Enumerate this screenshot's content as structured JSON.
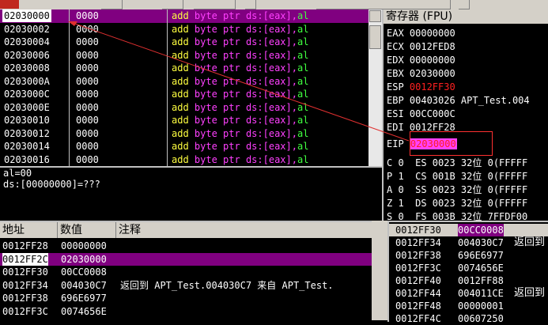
{
  "disasm": {
    "rows": [
      {
        "addr": "02030000",
        "hex": "0000",
        "op": "add",
        "rest": "byte ptr ds:[eax],",
        "reg": "al",
        "selected": true
      },
      {
        "addr": "02030002",
        "hex": "0000",
        "op": "add",
        "rest": "byte ptr ds:[eax],",
        "reg": "al"
      },
      {
        "addr": "02030004",
        "hex": "0000",
        "op": "add",
        "rest": "byte ptr ds:[eax],",
        "reg": "al"
      },
      {
        "addr": "02030006",
        "hex": "0000",
        "op": "add",
        "rest": "byte ptr ds:[eax],",
        "reg": "al"
      },
      {
        "addr": "02030008",
        "hex": "0000",
        "op": "add",
        "rest": "byte ptr ds:[eax],",
        "reg": "al"
      },
      {
        "addr": "0203000A",
        "hex": "0000",
        "op": "add",
        "rest": "byte ptr ds:[eax],",
        "reg": "al"
      },
      {
        "addr": "0203000C",
        "hex": "0000",
        "op": "add",
        "rest": "byte ptr ds:[eax],",
        "reg": "al"
      },
      {
        "addr": "0203000E",
        "hex": "0000",
        "op": "add",
        "rest": "byte ptr ds:[eax],",
        "reg": "al"
      },
      {
        "addr": "02030010",
        "hex": "0000",
        "op": "add",
        "rest": "byte ptr ds:[eax],",
        "reg": "al"
      },
      {
        "addr": "02030012",
        "hex": "0000",
        "op": "add",
        "rest": "byte ptr ds:[eax],",
        "reg": "al"
      },
      {
        "addr": "02030014",
        "hex": "0000",
        "op": "add",
        "rest": "byte ptr ds:[eax],",
        "reg": "al"
      },
      {
        "addr": "02030016",
        "hex": "0000",
        "op": "add",
        "rest": "byte ptr ds:[eax],",
        "reg": "al"
      }
    ]
  },
  "info": {
    "line1": "al=00",
    "line2": "ds:[00000000]=???"
  },
  "registers": {
    "title": "寄存器 (FPU)",
    "EAX": "EAX 00000000",
    "ECX": "ECX 0012FED8",
    "EDX": "EDX 00000000",
    "EBX": "EBX 02030000",
    "ESP_name": "ESP ",
    "ESP_val": "0012FF30",
    "EBP": "EBP 00403026 APT_Test.004",
    "ESI": "ESI 00CC000C",
    "EDI": "EDI 0012FF28",
    "EIP_name": "EIP",
    "EIP_val": "02030000",
    "flags": [
      "C 0  ES 0023 32位 0(FFFFF",
      "P 1  CS 001B 32位 0(FFFFF",
      "A 0  SS 0023 32位 0(FFFFF",
      "Z 1  DS 0023 32位 0(FFFFF",
      "S 0  FS 003B 32位 7FFDF00"
    ]
  },
  "dump": {
    "headers": {
      "addr": "地址",
      "value": "数值",
      "comment": "注释"
    },
    "rows": [
      {
        "a": "0012FF28",
        "v": "00000000",
        "c": ""
      },
      {
        "a": "0012FF2C",
        "v": "02030000",
        "c": "",
        "hl": true
      },
      {
        "a": "0012FF30",
        "v": "00CC0008",
        "c": ""
      },
      {
        "a": "0012FF34",
        "v": "004030C7",
        "c": "返回到 APT_Test.004030C7 来自 APT_Test."
      },
      {
        "a": "0012FF38",
        "v": "696E6977",
        "c": ""
      },
      {
        "a": "0012FF3C",
        "v": "0074656E",
        "c": ""
      }
    ]
  },
  "stack": {
    "rows": [
      {
        "a": "0012FF30",
        "v": "00CC0008",
        "c": "",
        "top": true
      },
      {
        "a": "0012FF34",
        "v": "004030C7",
        "c": "返回到"
      },
      {
        "a": "0012FF38",
        "v": "696E6977",
        "c": ""
      },
      {
        "a": "0012FF3C",
        "v": "0074656E",
        "c": ""
      },
      {
        "a": "0012FF40",
        "v": "0012FF88",
        "c": ""
      },
      {
        "a": "0012FF44",
        "v": "004011CE",
        "c": "返回到"
      },
      {
        "a": "0012FF48",
        "v": "00000001",
        "c": ""
      },
      {
        "a": "0012FF4C",
        "v": "00607250",
        "c": ""
      }
    ]
  },
  "colors": {
    "selection": "#800080",
    "eip_box": "#ff3030",
    "arrow": "#e03030"
  }
}
